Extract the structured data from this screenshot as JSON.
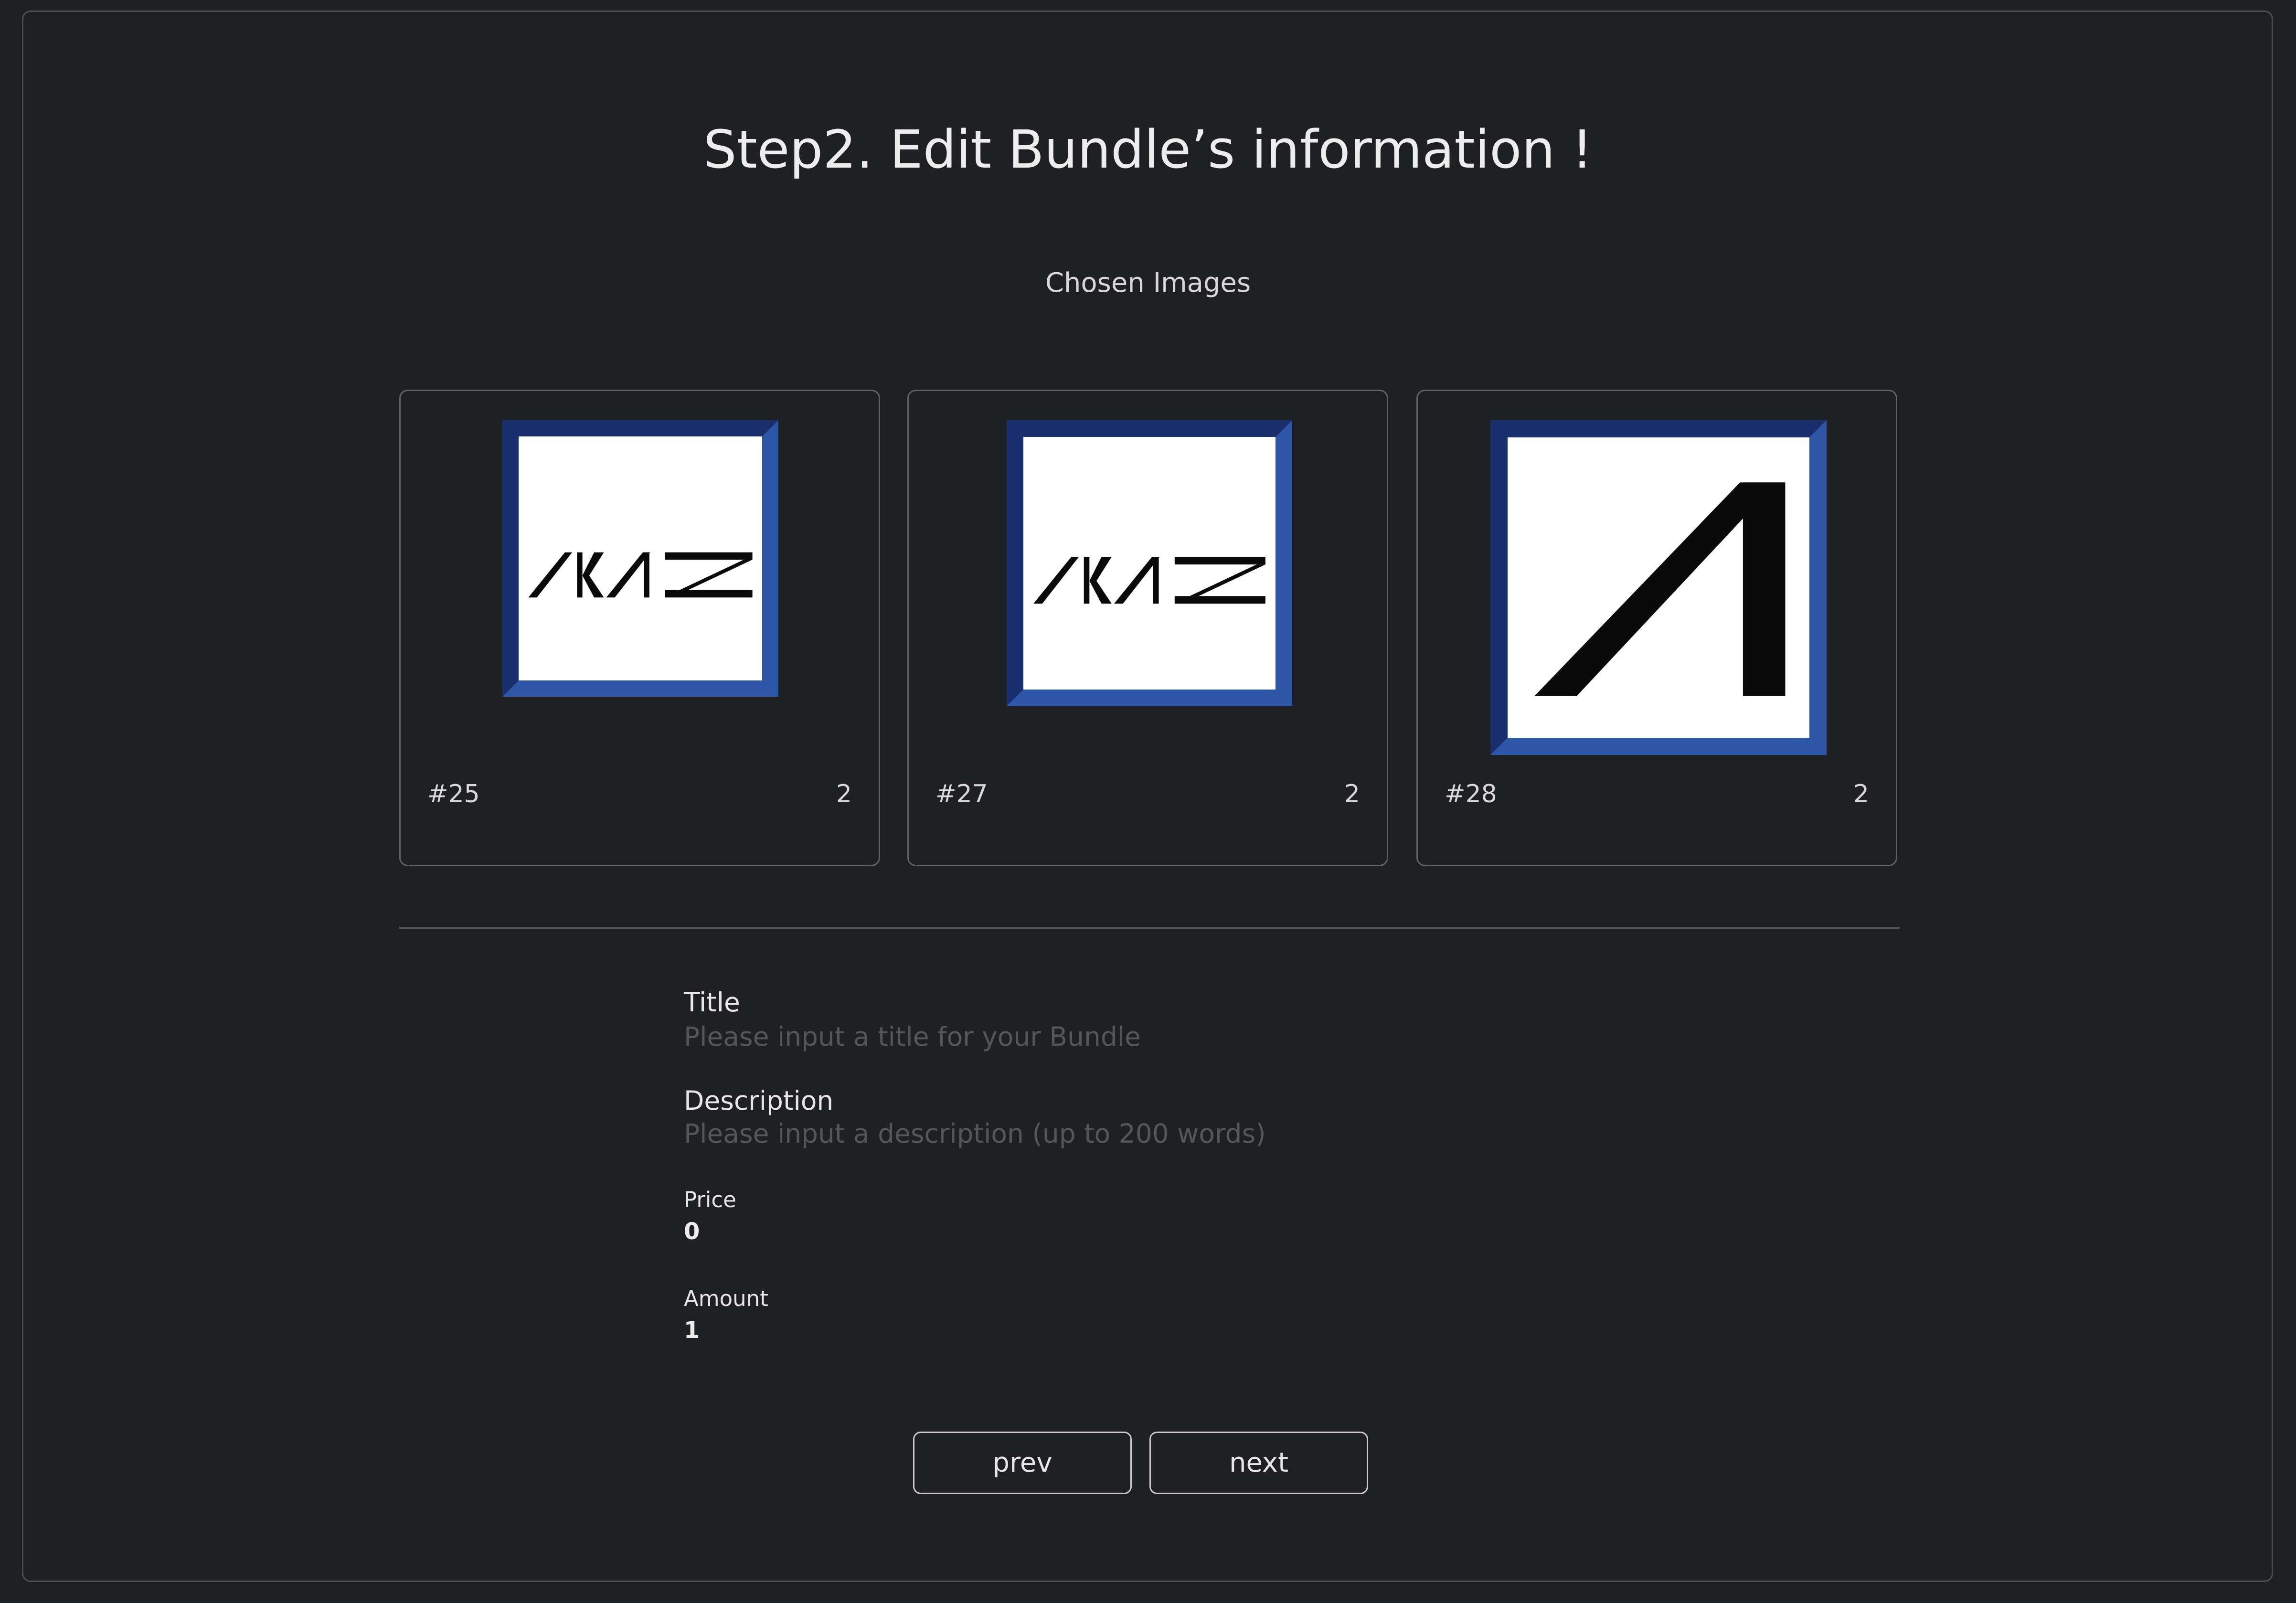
{
  "header": {
    "title": "Step2. Edit Bundle’s information !"
  },
  "chosen_images": {
    "label": "Chosen Images",
    "cards": [
      {
        "id": "#25",
        "count": "2",
        "image": "akas-logo",
        "image_text": "AKAS"
      },
      {
        "id": "#27",
        "count": "2",
        "image": "akas-logo",
        "image_text": "AKAS"
      },
      {
        "id": "#28",
        "count": "2",
        "image": "a-logo"
      }
    ]
  },
  "form": {
    "title": {
      "label": "Title",
      "placeholder": "Please input a title for your Bundle",
      "value": ""
    },
    "description": {
      "label": "Description",
      "placeholder": "Please input a description (up to 200 words)",
      "value": ""
    },
    "price": {
      "label": "Price",
      "value": "0"
    },
    "amount": {
      "label": "Amount",
      "value": "1"
    }
  },
  "buttons": {
    "prev": "prev",
    "next": "next"
  },
  "colors": {
    "background": "#1f2023",
    "frame_blue": "#2d55a8",
    "frame_blue_dark": "#1a2e6e",
    "placeholder": "#55565a"
  }
}
